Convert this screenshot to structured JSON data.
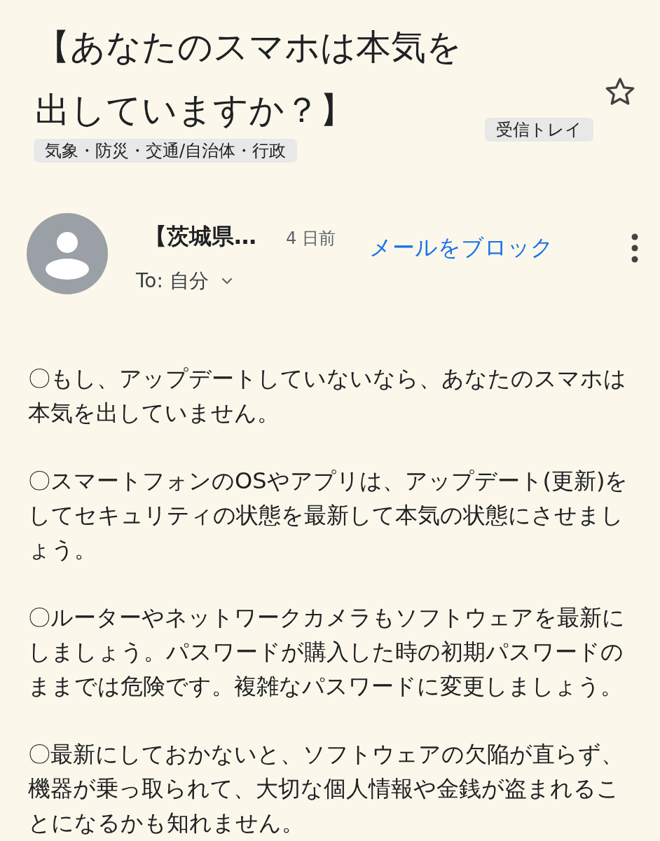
{
  "subject": "【あなたのスマホは本気を出していますか？】",
  "folder_label": "受信トレイ",
  "labels": [
    "気象・防災・交通/自治体・行政"
  ],
  "starred": false,
  "sender": {
    "name": "【茨城県…",
    "time": "4 日前",
    "recipient": "To: 自分"
  },
  "block_action": "メールをブロック",
  "body": [
    "〇もし、アップデートしていないなら、あなたのスマホは本気を出していません。",
    "〇スマートフォンのOSやアプリは、アップデート(更新)をしてセキュリティの状態を最新して本気の状態にさせましょう。",
    "〇ルーターやネットワークカメラもソフトウェアを最新にしましょう。パスワードが購入した時の初期パスワードのままでは危険です。複雑なパスワードに変更しましょう。",
    "〇最新にしておかないと、ソフトウェアの欠陥が直らず、機器が乗っ取られて、大切な個人情報や金銭が盗まれることになるかも知れません。"
  ]
}
